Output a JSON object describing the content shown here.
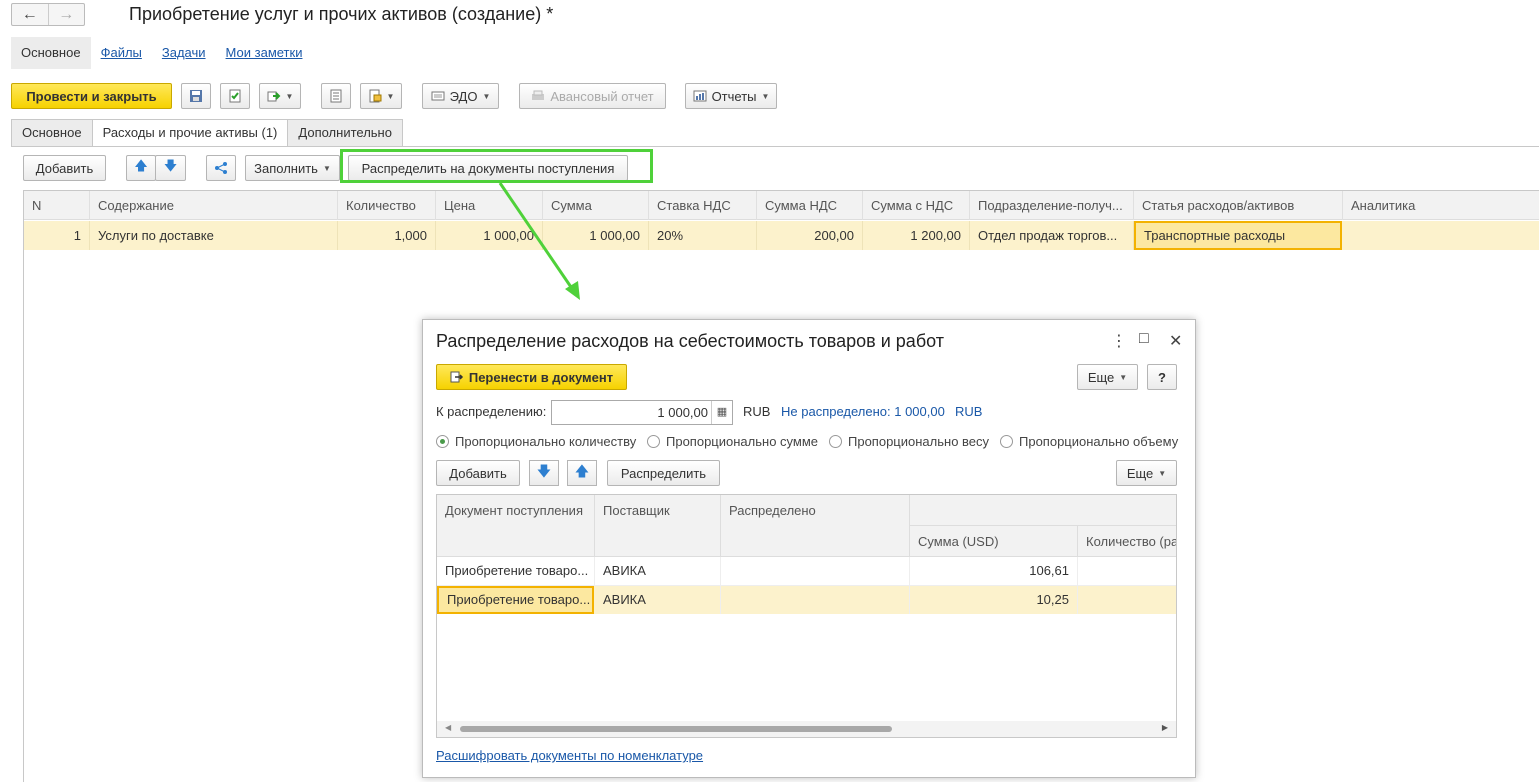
{
  "window": {
    "title": "Приобретение услуг и прочих активов (создание) *",
    "back_icon": "←",
    "forward_icon": "→"
  },
  "sections": [
    {
      "label": "Основное"
    },
    {
      "label": "Файлы"
    },
    {
      "label": "Задачи"
    },
    {
      "label": "Мои заметки"
    }
  ],
  "toolbar": {
    "post_close": "Провести и закрыть",
    "edo": "ЭДО",
    "advance_report": "Авансовый отчет",
    "reports": "Отчеты"
  },
  "tabs": [
    {
      "label": "Основное"
    },
    {
      "label": "Расходы и прочие активы (1)"
    },
    {
      "label": "Дополнительно"
    }
  ],
  "table_toolbar": {
    "add": "Добавить",
    "fill": "Заполнить",
    "distribute": "Распределить на документы поступления"
  },
  "main_table": {
    "columns": [
      "N",
      "Содержание",
      "Количество",
      "Цена",
      "Сумма",
      "Ставка НДС",
      "Сумма НДС",
      "Сумма с НДС",
      "Подразделение-получ...",
      "Статья расходов/активов",
      "Аналитика"
    ],
    "rows": [
      {
        "n": "1",
        "content": "Услуги по доставке",
        "qty": "1,000",
        "price": "1 000,00",
        "sum": "1 000,00",
        "vat_rate": "20%",
        "vat_sum": "200,00",
        "total": "1 200,00",
        "department": "Отдел продаж торгов...",
        "expense_item": "Транспортные расходы",
        "analytics": ""
      }
    ]
  },
  "dialog": {
    "title": "Распределение расходов на себестоимость товаров и работ",
    "more_icon": "⋮",
    "maximize_icon": "□",
    "close_icon": "✕",
    "transfer": "Перенести в документ",
    "more": "Еще",
    "help": "?",
    "to_distribute_label": "К распределению:",
    "to_distribute_value": "1 000,00",
    "currency": "RUB",
    "undistributed": "Не распределено: 1 000,00",
    "undistributed_currency": "RUB",
    "radios": [
      {
        "label": "Пропорционально количеству",
        "checked": true
      },
      {
        "label": "Пропорционально сумме",
        "checked": false
      },
      {
        "label": "Пропорционально весу",
        "checked": false
      },
      {
        "label": "Пропорционально объему",
        "checked": false
      }
    ],
    "add": "Добавить",
    "distribute": "Распределить",
    "more2": "Еще",
    "columns": {
      "doc": "Документ поступления",
      "supplier": "Поставщик",
      "distributed": "Распределено",
      "sum_usd": "Сумма (USD)",
      "qty": "Количество (ра"
    },
    "rows": [
      {
        "doc": "Приобретение товаро...",
        "supplier": "АВИКА",
        "distributed": "",
        "sum_usd": "106,61"
      },
      {
        "doc": "Приобретение товаро...",
        "supplier": "АВИКА",
        "distributed": "",
        "sum_usd": "10,25"
      }
    ],
    "footer_link": "Расшифровать документы по номенклатуре"
  }
}
